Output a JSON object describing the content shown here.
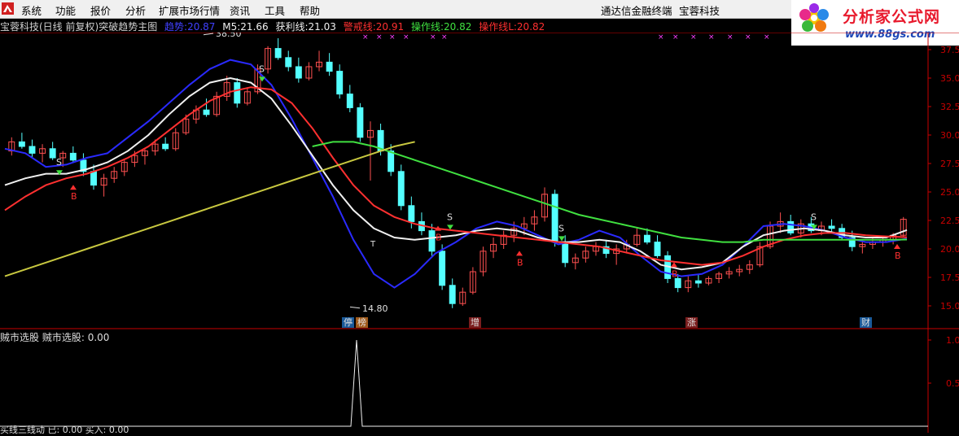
{
  "menubar": {
    "items": [
      "系统",
      "功能",
      "报价",
      "分析",
      "扩展市场行情",
      "资讯",
      "工具",
      "帮助"
    ],
    "right_labels": [
      "通达信金融终端",
      "宝蓉科技"
    ]
  },
  "logo": {
    "title": "分析家公式网",
    "url": "www.88gs.com"
  },
  "infoline": {
    "stock": "宝蓉科技(日线 前复权)",
    "formula": "突破趋势主图",
    "trend_label": "趋势:",
    "trend_value": "20.87",
    "m5_label": "M5:",
    "m5_value": "21.66",
    "profit_label": "获利线:",
    "profit_value": "21.03",
    "warn_label": "警戒线:",
    "warn_value": "20.91",
    "op_label": "操作线:",
    "op_value": "20.82",
    "opl_label": "操作线L:",
    "opl_value": "20.82"
  },
  "price_axis": {
    "labels": [
      "37.5",
      "35.0",
      "32.5",
      "30.0",
      "27.5",
      "25.0",
      "22.5",
      "20.0",
      "17.5",
      "15.0"
    ]
  },
  "annotations": {
    "high_label": "38.50",
    "low_label": "14.80",
    "buy_mark": "B",
    "sell_mark": "S",
    "t_mark": "T"
  },
  "event_tags": [
    {
      "text": "停",
      "bg": "#1a5a9a",
      "fg": "#e0e0e0"
    },
    {
      "text": "榜",
      "bg": "#a05a1a",
      "fg": "#e0e0e0"
    },
    {
      "text": "增",
      "bg": "#7a1e1e",
      "fg": "#e0e0e0"
    },
    {
      "text": "涨",
      "bg": "#7a1e1e",
      "fg": "#e0e0e0"
    },
    {
      "text": "财",
      "bg": "#1a5a9a",
      "fg": "#e0e0e0"
    }
  ],
  "sub_panel": {
    "title": "贼市选股",
    "value_label": "贼市选股:",
    "value": "0.00",
    "axis_labels": [
      "1.0",
      "0.5"
    ]
  },
  "bottom_line": {
    "text": "买线三线动 已: 0.00  买入: 0.00"
  },
  "colors": {
    "bg": "#000000",
    "axis": "#c80000",
    "up": "#ff5050",
    "down": "#54ffff",
    "trend_line": "#2a2aff",
    "m5": "#f0f0f0",
    "profit": "#ff3030",
    "warn": "#ff3030",
    "op": "#40e040",
    "op_l": "#c8c840"
  },
  "chart_data": {
    "type": "candlestick",
    "y_range": [
      14.0,
      39.0
    ],
    "ohlc": [
      [
        28.6,
        29.8,
        28.2,
        29.4
      ],
      [
        29.4,
        30.2,
        28.8,
        29.0
      ],
      [
        29.0,
        29.6,
        28.0,
        28.4
      ],
      [
        28.4,
        29.2,
        27.6,
        28.8
      ],
      [
        28.8,
        29.4,
        27.8,
        28.0
      ],
      [
        28.0,
        28.6,
        27.2,
        28.4
      ],
      [
        28.4,
        29.0,
        27.6,
        27.8
      ],
      [
        27.8,
        28.4,
        26.4,
        26.8
      ],
      [
        26.8,
        27.4,
        25.2,
        25.6
      ],
      [
        25.6,
        26.6,
        24.6,
        26.2
      ],
      [
        26.2,
        27.2,
        25.8,
        26.8
      ],
      [
        26.8,
        27.8,
        26.4,
        27.6
      ],
      [
        27.6,
        28.6,
        27.2,
        28.2
      ],
      [
        28.2,
        28.8,
        27.4,
        28.6
      ],
      [
        28.6,
        29.6,
        28.2,
        29.2
      ],
      [
        29.2,
        29.8,
        28.6,
        28.8
      ],
      [
        28.8,
        30.6,
        28.6,
        30.2
      ],
      [
        30.2,
        31.8,
        30.0,
        31.4
      ],
      [
        31.4,
        32.6,
        31.0,
        32.2
      ],
      [
        32.2,
        33.2,
        31.6,
        31.8
      ],
      [
        31.8,
        33.8,
        31.6,
        33.4
      ],
      [
        33.4,
        35.2,
        33.0,
        34.6
      ],
      [
        34.6,
        35.0,
        32.4,
        32.8
      ],
      [
        32.8,
        34.2,
        32.6,
        33.8
      ],
      [
        33.8,
        36.2,
        33.6,
        35.8
      ],
      [
        35.8,
        37.8,
        35.4,
        37.6
      ],
      [
        37.6,
        38.5,
        36.6,
        36.8
      ],
      [
        36.8,
        37.4,
        35.6,
        36.0
      ],
      [
        36.0,
        36.8,
        34.6,
        35.0
      ],
      [
        35.0,
        36.4,
        34.8,
        36.0
      ],
      [
        36.0,
        37.4,
        35.6,
        36.4
      ],
      [
        36.4,
        37.2,
        35.2,
        35.6
      ],
      [
        35.6,
        36.2,
        33.2,
        33.6
      ],
      [
        33.6,
        34.4,
        32.0,
        32.4
      ],
      [
        32.4,
        32.8,
        29.4,
        29.8
      ],
      [
        29.8,
        31.2,
        26.0,
        30.4
      ],
      [
        30.4,
        31.0,
        28.2,
        28.6
      ],
      [
        28.6,
        29.2,
        26.4,
        26.8
      ],
      [
        26.8,
        27.4,
        23.4,
        23.8
      ],
      [
        23.8,
        24.6,
        21.8,
        22.4
      ],
      [
        22.4,
        23.2,
        21.2,
        21.6
      ],
      [
        21.6,
        22.2,
        19.4,
        19.8
      ],
      [
        19.8,
        20.4,
        16.4,
        16.8
      ],
      [
        16.8,
        17.4,
        14.8,
        15.2
      ],
      [
        15.2,
        16.6,
        15.0,
        16.2
      ],
      [
        16.2,
        18.4,
        16.0,
        18.0
      ],
      [
        18.0,
        20.2,
        17.6,
        19.8
      ],
      [
        19.8,
        21.0,
        19.2,
        20.4
      ],
      [
        20.4,
        21.6,
        20.0,
        21.2
      ],
      [
        21.2,
        22.4,
        20.6,
        21.8
      ],
      [
        21.8,
        22.8,
        21.2,
        22.2
      ],
      [
        22.2,
        23.4,
        21.6,
        22.8
      ],
      [
        22.8,
        25.4,
        22.4,
        24.8
      ],
      [
        24.8,
        25.2,
        20.2,
        20.6
      ],
      [
        20.6,
        21.2,
        18.4,
        18.8
      ],
      [
        18.8,
        19.6,
        18.2,
        19.2
      ],
      [
        19.2,
        20.2,
        18.8,
        19.8
      ],
      [
        19.8,
        20.6,
        19.4,
        20.2
      ],
      [
        20.2,
        20.8,
        19.2,
        19.6
      ],
      [
        19.6,
        20.4,
        18.6,
        20.0
      ],
      [
        20.0,
        20.8,
        19.6,
        20.4
      ],
      [
        20.4,
        21.8,
        20.2,
        21.2
      ],
      [
        21.2,
        21.8,
        20.4,
        20.6
      ],
      [
        20.6,
        21.2,
        19.2,
        19.4
      ],
      [
        19.4,
        19.8,
        17.0,
        17.4
      ],
      [
        17.4,
        17.8,
        16.2,
        16.6
      ],
      [
        16.6,
        17.6,
        16.2,
        17.2
      ],
      [
        17.2,
        17.8,
        16.6,
        17.0
      ],
      [
        17.0,
        17.6,
        16.8,
        17.4
      ],
      [
        17.4,
        18.0,
        17.0,
        17.8
      ],
      [
        17.8,
        18.4,
        17.4,
        18.0
      ],
      [
        18.0,
        18.6,
        17.6,
        18.2
      ],
      [
        18.2,
        19.0,
        17.8,
        18.6
      ],
      [
        18.6,
        20.6,
        18.4,
        20.2
      ],
      [
        20.2,
        22.4,
        20.0,
        22.0
      ],
      [
        22.0,
        23.2,
        21.4,
        22.4
      ],
      [
        22.4,
        23.0,
        21.2,
        21.4
      ],
      [
        21.4,
        22.6,
        21.0,
        22.2
      ],
      [
        22.2,
        22.8,
        21.4,
        21.6
      ],
      [
        21.6,
        22.4,
        21.2,
        22.0
      ],
      [
        22.0,
        22.6,
        21.4,
        21.8
      ],
      [
        21.8,
        22.2,
        20.8,
        21.0
      ],
      [
        21.0,
        21.6,
        19.8,
        20.2
      ],
      [
        20.2,
        20.8,
        19.6,
        20.4
      ],
      [
        20.4,
        21.0,
        20.0,
        20.6
      ],
      [
        20.6,
        21.0,
        20.2,
        20.8
      ],
      [
        20.8,
        21.4,
        20.4,
        21.2
      ],
      [
        21.2,
        22.8,
        21.0,
        22.6
      ]
    ],
    "series": [
      {
        "name": "趋势",
        "values": [
          28.8,
          28.4,
          27.2,
          27.4,
          28.0,
          28.4,
          29.8,
          31.2,
          32.8,
          34.4,
          35.8,
          36.6,
          36.2,
          34.4,
          31.4,
          28.0,
          24.6,
          20.8,
          17.8,
          16.6,
          17.8,
          19.6,
          20.6,
          21.8,
          22.4,
          22.0,
          21.2,
          20.4,
          20.8,
          21.6,
          21.0,
          19.4,
          18.0,
          17.6,
          17.8,
          18.6,
          20.2,
          22.0,
          22.2,
          22.0,
          21.6,
          21.0,
          20.6,
          20.6,
          20.9
        ]
      },
      {
        "name": "M5",
        "values": [
          25.6,
          26.2,
          26.6,
          26.6,
          27.0,
          27.6,
          28.6,
          30.0,
          31.8,
          33.4,
          34.6,
          35.0,
          34.6,
          33.2,
          30.8,
          28.2,
          25.6,
          23.4,
          21.8,
          21.0,
          20.8,
          21.0,
          21.2,
          21.6,
          21.8,
          21.6,
          21.0,
          20.6,
          20.6,
          20.8,
          20.6,
          19.8,
          18.6,
          18.2,
          18.4,
          18.8,
          20.2,
          21.2,
          21.6,
          21.8,
          21.6,
          21.2,
          21.0,
          21.0,
          21.66
        ]
      },
      {
        "name": "获利线",
        "values": [
          23.4,
          24.6,
          25.6,
          26.2,
          26.6,
          27.2,
          28.0,
          29.0,
          30.4,
          31.8,
          33.0,
          33.8,
          34.2,
          34.0,
          32.8,
          30.6,
          28.0,
          25.6,
          23.8,
          22.8,
          22.2,
          21.8,
          21.6,
          21.4,
          21.2,
          21.0,
          20.8,
          20.6,
          20.4,
          20.2,
          19.8,
          19.4,
          19.0,
          18.8,
          18.6,
          18.8,
          19.4,
          20.2,
          20.8,
          21.2,
          21.4,
          21.4,
          21.2,
          21.1,
          21.03
        ]
      },
      {
        "name": "操作线",
        "values": [
          null,
          null,
          null,
          null,
          null,
          null,
          null,
          null,
          null,
          null,
          null,
          null,
          null,
          null,
          null,
          29.0,
          29.4,
          29.4,
          29.0,
          28.4,
          27.8,
          27.2,
          26.6,
          26.0,
          25.4,
          24.8,
          24.2,
          23.6,
          23.0,
          22.6,
          22.2,
          21.8,
          21.4,
          21.0,
          20.8,
          20.6,
          20.6,
          20.8,
          20.8,
          20.8,
          20.8,
          20.8,
          20.8,
          20.8,
          20.82
        ]
      },
      {
        "name": "操作线L",
        "values": [
          17.6,
          18.2,
          18.8,
          19.4,
          20.0,
          20.6,
          21.2,
          21.8,
          22.4,
          23.0,
          23.6,
          24.2,
          24.8,
          25.4,
          26.0,
          26.6,
          27.2,
          27.8,
          28.4,
          29.0,
          29.4,
          null,
          null,
          null,
          null,
          null,
          null,
          null,
          null,
          null,
          null,
          null,
          null,
          null,
          null,
          null,
          null,
          null,
          null,
          null,
          null,
          null,
          null,
          null,
          null
        ]
      }
    ],
    "sub_series": {
      "name": "贼市选股",
      "spike_index": 44,
      "spike_value": 1.0
    }
  }
}
